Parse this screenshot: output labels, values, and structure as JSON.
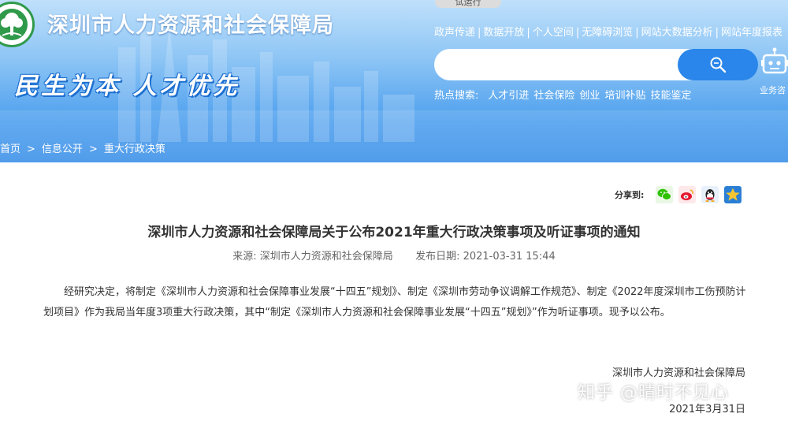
{
  "header": {
    "site_title": "深圳市人力资源和社会保障局",
    "slogan": "民生为本  人才优先",
    "trial_tag": "试运行",
    "top_links": [
      "政声传递",
      "数据开放",
      "个人空间",
      "无障碍浏览",
      "网站大数据分析",
      "网站年度报表"
    ],
    "search": {
      "placeholder": "",
      "value": ""
    },
    "robot_label": "业务咨",
    "hot_search": {
      "label": "热点搜索:",
      "items": [
        "人才引进",
        "社会保险",
        "创业",
        "培训补贴",
        "技能鉴定"
      ]
    }
  },
  "breadcrumb": [
    "首页",
    "信息公开",
    "重大行政决策"
  ],
  "share": {
    "label": "分享到:",
    "icons": [
      "wechat-icon",
      "weibo-icon",
      "qq-icon",
      "qzone-icon"
    ]
  },
  "article": {
    "title": "深圳市人力资源和社会保障局关于公布2021年重大行政决策事项及听证事项的通知",
    "source_label": "来源:",
    "source": "深圳市人力资源和社会保障局",
    "date_label": "发布日期:",
    "date": "2021-03-31 15:44",
    "body": "经研究决定，将制定《深圳市人力资源和社会保障事业发展“十四五”规划》、制定《深圳市劳动争议调解工作规范》、制定《2022年度深圳市工伤预防计划项目》作为我局当年度3项重大行政决策，其中“制定《深圳市人力资源和社会保障事业发展“十四五”规划》”作为听证事项。现予以公布。",
    "signature": "深圳市人力资源和社会保障局",
    "sign_date": "2021年3月31日"
  },
  "watermark": "知乎 @晴时不见心",
  "colors": {
    "header_blue": "#3a8fe8",
    "search_button": "#2a86ea",
    "logo_green": "#2f9a4a",
    "wechat_green": "#2dc100",
    "weibo_red": "#e6162d",
    "qzone_yellow": "#f7c531"
  }
}
